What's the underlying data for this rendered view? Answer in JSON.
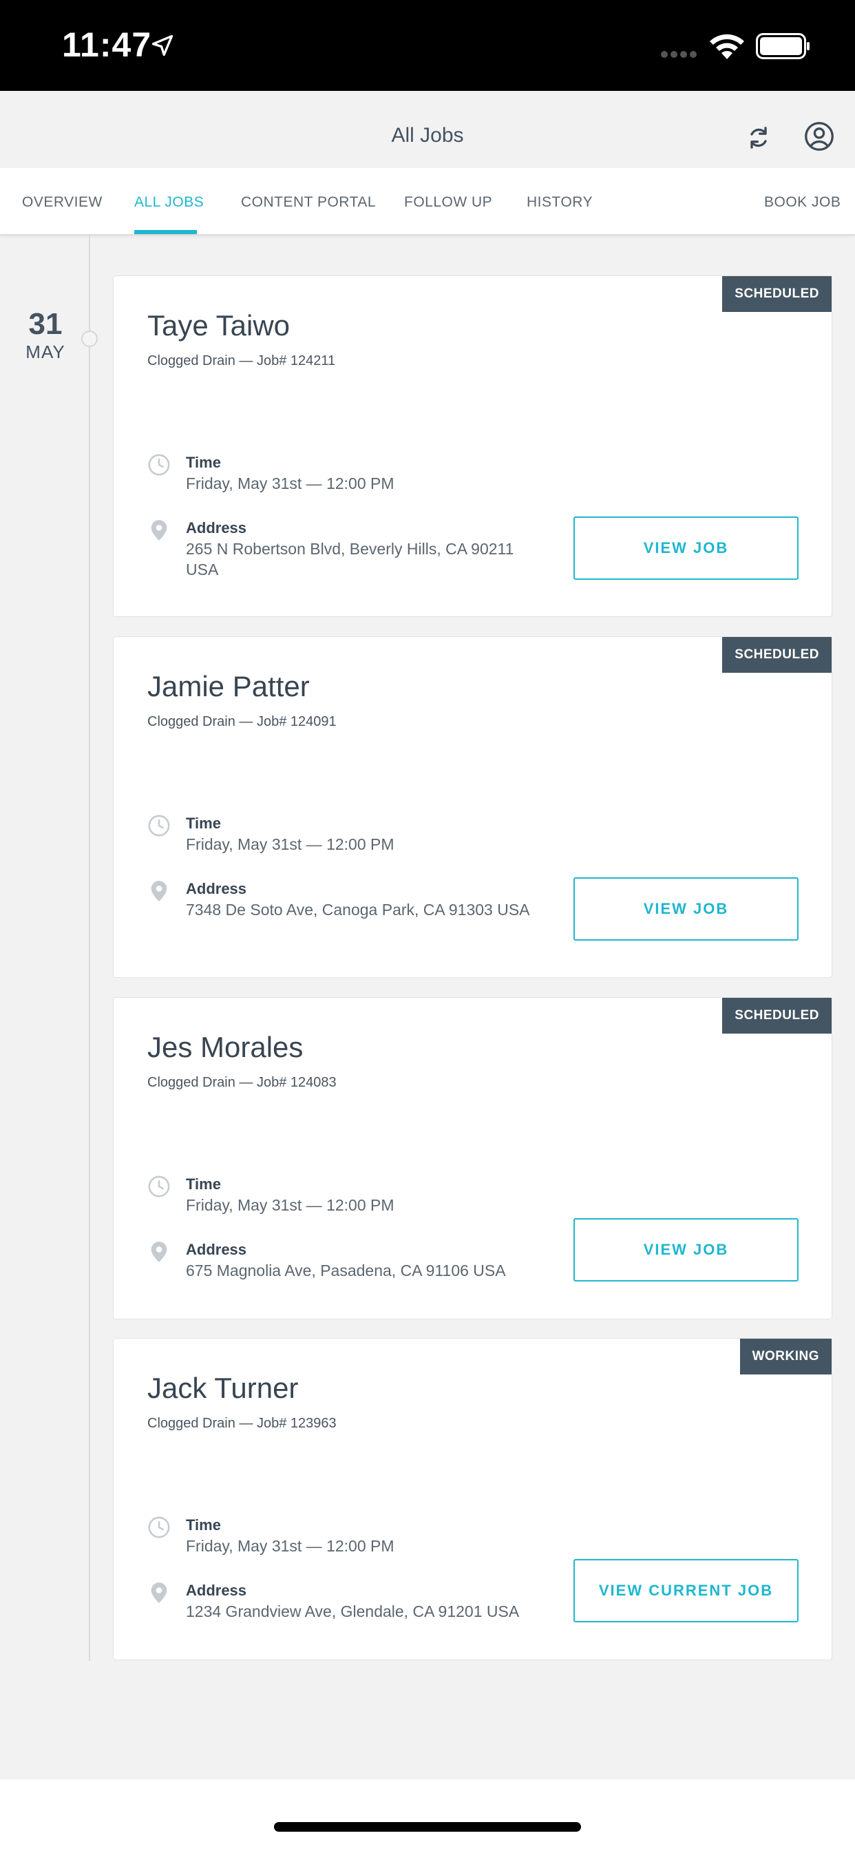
{
  "status_bar": {
    "time": "11:47"
  },
  "header": {
    "title": "All Jobs"
  },
  "tabs": [
    {
      "label": "OVERVIEW"
    },
    {
      "label": "ALL JOBS"
    },
    {
      "label": "CONTENT PORTAL"
    },
    {
      "label": "FOLLOW UP"
    },
    {
      "label": "HISTORY"
    },
    {
      "label": "BOOK JOB"
    }
  ],
  "active_tab": "ALL JOBS",
  "timeline": {
    "day": "31",
    "month": "MAY"
  },
  "jobs": [
    {
      "status": "SCHEDULED",
      "client": "Taye Taiwo",
      "meta": "Clogged Drain — Job# 124211",
      "time_label": "Time",
      "time_value": "Friday, May 31st — 12:00 PM",
      "address_label": "Address",
      "address_value": "265 N Robertson Blvd, Beverly Hills, CA 90211 USA",
      "button": "VIEW JOB"
    },
    {
      "status": "SCHEDULED",
      "client": "Jamie Patter",
      "meta": "Clogged Drain — Job# 124091",
      "time_label": "Time",
      "time_value": "Friday, May 31st — 12:00 PM",
      "address_label": "Address",
      "address_value": "7348 De Soto Ave, Canoga Park, CA 91303 USA",
      "button": "VIEW JOB"
    },
    {
      "status": "SCHEDULED",
      "client": "Jes Morales",
      "meta": "Clogged Drain — Job# 124083",
      "time_label": "Time",
      "time_value": "Friday, May 31st — 12:00 PM",
      "address_label": "Address",
      "address_value": "675 Magnolia Ave, Pasadena, CA 91106 USA",
      "button": "VIEW JOB"
    },
    {
      "status": "WORKING",
      "client": "Jack Turner",
      "meta": "Clogged Drain — Job# 123963",
      "time_label": "Time",
      "time_value": "Friday, May 31st — 12:00 PM",
      "address_label": "Address",
      "address_value": "1234 Grandview Ave, Glendale, CA 91201 USA",
      "button": "VIEW CURRENT JOB"
    }
  ],
  "colors": {
    "accent": "#1fb7cf",
    "badge": "#445663",
    "text": "#384552"
  },
  "icons": [
    "location-arrow-icon",
    "signal-icon",
    "wifi-icon",
    "battery-icon",
    "sync-icon",
    "account-icon",
    "clock-icon",
    "map-pin-icon"
  ]
}
